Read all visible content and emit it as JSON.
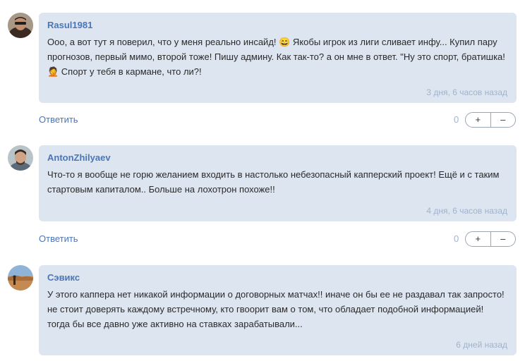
{
  "comments": [
    {
      "author": "Rasul1981",
      "text": "Ооо, а вот тут я поверил, что у меня реально инсайд! 😄 Якобы игрок из лиги сливает инфу... Купил пару прогнозов, первый мимо, второй тоже! Пишу админу. Как так-то? а он мне в ответ. \"Ну это спорт, братишка! 🤦 Спорт у тебя в кармане, что ли?!",
      "time": "3 дня, 6 часов назад",
      "reply_label": "Ответить",
      "score": "0",
      "plus": "+",
      "minus": "–"
    },
    {
      "author": "AntonZhilyaev",
      "text": "Что-то я вообще не горю желанием входить в настолько небезопасный капперский проект! Ещё и с таким стартовым капиталом.. Больше на лохотрон похоже!!",
      "time": "4 дня, 6 часов назад",
      "reply_label": "Ответить",
      "score": "0",
      "plus": "+",
      "minus": "–"
    },
    {
      "author": "Сэвикс",
      "text": "У этого каппера нет никакой информации о договорных матчах!! иначе он бы ее не раздавал так запросто! не стоит доверять каждому встречному, кто гвоорит вам о том, что обладает подобной информацией! тогда бы все давно уже активно на ставках зарабатывали...",
      "time": "6 дней назад"
    }
  ]
}
